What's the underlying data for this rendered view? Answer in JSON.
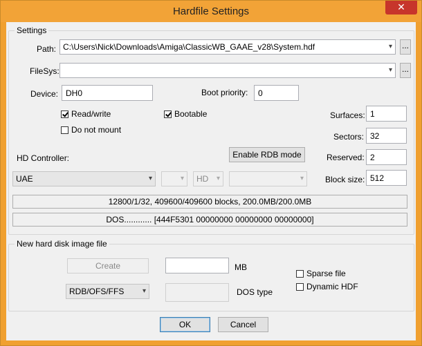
{
  "window": {
    "title": "Hardfile Settings",
    "close_label": "✕"
  },
  "settings": {
    "group_label": "Settings",
    "path_label": "Path:",
    "path_value": "C:\\Users\\Nick\\Downloads\\Amiga\\ClassicWB_GAAE_v28\\System.hdf",
    "browse_label": "...",
    "filesys_label": "FileSys:",
    "filesys_value": "",
    "device_label": "Device:",
    "device_value": "DH0",
    "boot_priority_label": "Boot priority:",
    "boot_priority_value": "0",
    "read_write_label": "Read/write",
    "bootable_label": "Bootable",
    "do_not_mount_label": "Do not mount",
    "surfaces_label": "Surfaces:",
    "surfaces_value": "1",
    "sectors_label": "Sectors:",
    "sectors_value": "32",
    "reserved_label": "Reserved:",
    "reserved_value": "2",
    "block_size_label": "Block size:",
    "block_size_value": "512",
    "hd_controller_label": "HD Controller:",
    "enable_rdb_label": "Enable RDB mode",
    "controller_value": "UAE",
    "unit_value": "",
    "type_value": "HD",
    "extra_value": "",
    "geometry_info": "12800/1/32, 409600/409600 blocks, 200.0MB/200.0MB",
    "dos_info": "DOS............ [444F5301 00000000 00000000 00000000]"
  },
  "new_image": {
    "group_label": "New hard disk image file",
    "create_label": "Create",
    "size_value": "",
    "mb_label": "MB",
    "sparse_label": "Sparse file",
    "dynamic_label": "Dynamic HDF",
    "fs_value": "RDB/OFS/FFS",
    "dostype_value": "",
    "dostype_label": "DOS type"
  },
  "footer": {
    "ok_label": "OK",
    "cancel_label": "Cancel"
  },
  "icons": {
    "dropdown": "▾",
    "checkmark": "check"
  }
}
